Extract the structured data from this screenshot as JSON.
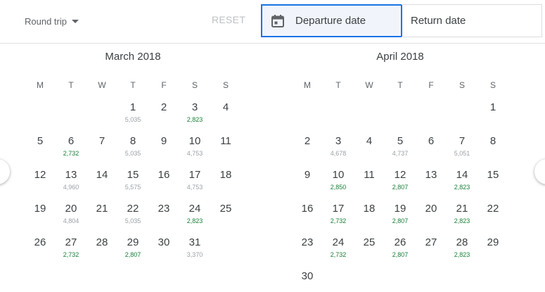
{
  "trip": {
    "type_label": "Round trip",
    "caret_icon": "caret-down-icon"
  },
  "reset_label": "RESET",
  "departure": {
    "label": "Departure date",
    "icon": "calendar-icon"
  },
  "return": {
    "label": "Return date"
  },
  "colors": {
    "accent": "#1a73e8",
    "low_price": "#188038",
    "normal_price": "#9aa0a6"
  },
  "weekdays": [
    "M",
    "T",
    "W",
    "T",
    "F",
    "S",
    "S"
  ],
  "months": [
    {
      "title": "March 2018",
      "weeks": [
        [
          null,
          null,
          null,
          {
            "d": "1",
            "p": "5,035",
            "low": false
          },
          {
            "d": "2"
          },
          {
            "d": "3",
            "p": "2,823",
            "low": true
          },
          {
            "d": "4"
          }
        ],
        [
          {
            "d": "5"
          },
          {
            "d": "6",
            "p": "2,732",
            "low": true
          },
          {
            "d": "7"
          },
          {
            "d": "8",
            "p": "5,035",
            "low": false
          },
          {
            "d": "9"
          },
          {
            "d": "10",
            "p": "4,753",
            "low": false
          },
          {
            "d": "11"
          }
        ],
        [
          {
            "d": "12"
          },
          {
            "d": "13",
            "p": "4,960",
            "low": false
          },
          {
            "d": "14"
          },
          {
            "d": "15",
            "p": "5,575",
            "low": false
          },
          {
            "d": "16"
          },
          {
            "d": "17",
            "p": "4,753",
            "low": false
          },
          {
            "d": "18"
          }
        ],
        [
          {
            "d": "19"
          },
          {
            "d": "20",
            "p": "4,804",
            "low": false
          },
          {
            "d": "21"
          },
          {
            "d": "22",
            "p": "5,035",
            "low": false
          },
          {
            "d": "23"
          },
          {
            "d": "24",
            "p": "2,823",
            "low": true
          },
          {
            "d": "25"
          }
        ],
        [
          {
            "d": "26"
          },
          {
            "d": "27",
            "p": "2,732",
            "low": true
          },
          {
            "d": "28"
          },
          {
            "d": "29",
            "p": "2,807",
            "low": true
          },
          {
            "d": "30"
          },
          {
            "d": "31",
            "p": "3,370",
            "low": false
          },
          null
        ]
      ]
    },
    {
      "title": "April 2018",
      "weeks": [
        [
          null,
          null,
          null,
          null,
          null,
          null,
          {
            "d": "1"
          }
        ],
        [
          {
            "d": "2"
          },
          {
            "d": "3",
            "p": "4,678",
            "low": false
          },
          {
            "d": "4"
          },
          {
            "d": "5",
            "p": "4,737",
            "low": false
          },
          {
            "d": "6"
          },
          {
            "d": "7",
            "p": "5,051",
            "low": false
          },
          {
            "d": "8"
          }
        ],
        [
          {
            "d": "9"
          },
          {
            "d": "10",
            "p": "2,850",
            "low": true
          },
          {
            "d": "11"
          },
          {
            "d": "12",
            "p": "2,807",
            "low": true
          },
          {
            "d": "13"
          },
          {
            "d": "14",
            "p": "2,823",
            "low": true
          },
          {
            "d": "15"
          }
        ],
        [
          {
            "d": "16"
          },
          {
            "d": "17",
            "p": "2,732",
            "low": true
          },
          {
            "d": "18"
          },
          {
            "d": "19",
            "p": "2,807",
            "low": true
          },
          {
            "d": "20"
          },
          {
            "d": "21",
            "p": "2,823",
            "low": true
          },
          {
            "d": "22"
          }
        ],
        [
          {
            "d": "23"
          },
          {
            "d": "24",
            "p": "2,732",
            "low": true
          },
          {
            "d": "25"
          },
          {
            "d": "26",
            "p": "2,807",
            "low": true
          },
          {
            "d": "27"
          },
          {
            "d": "28",
            "p": "2,823",
            "low": true
          },
          {
            "d": "29"
          }
        ],
        [
          {
            "d": "30"
          },
          null,
          null,
          null,
          null,
          null,
          null
        ]
      ]
    }
  ]
}
